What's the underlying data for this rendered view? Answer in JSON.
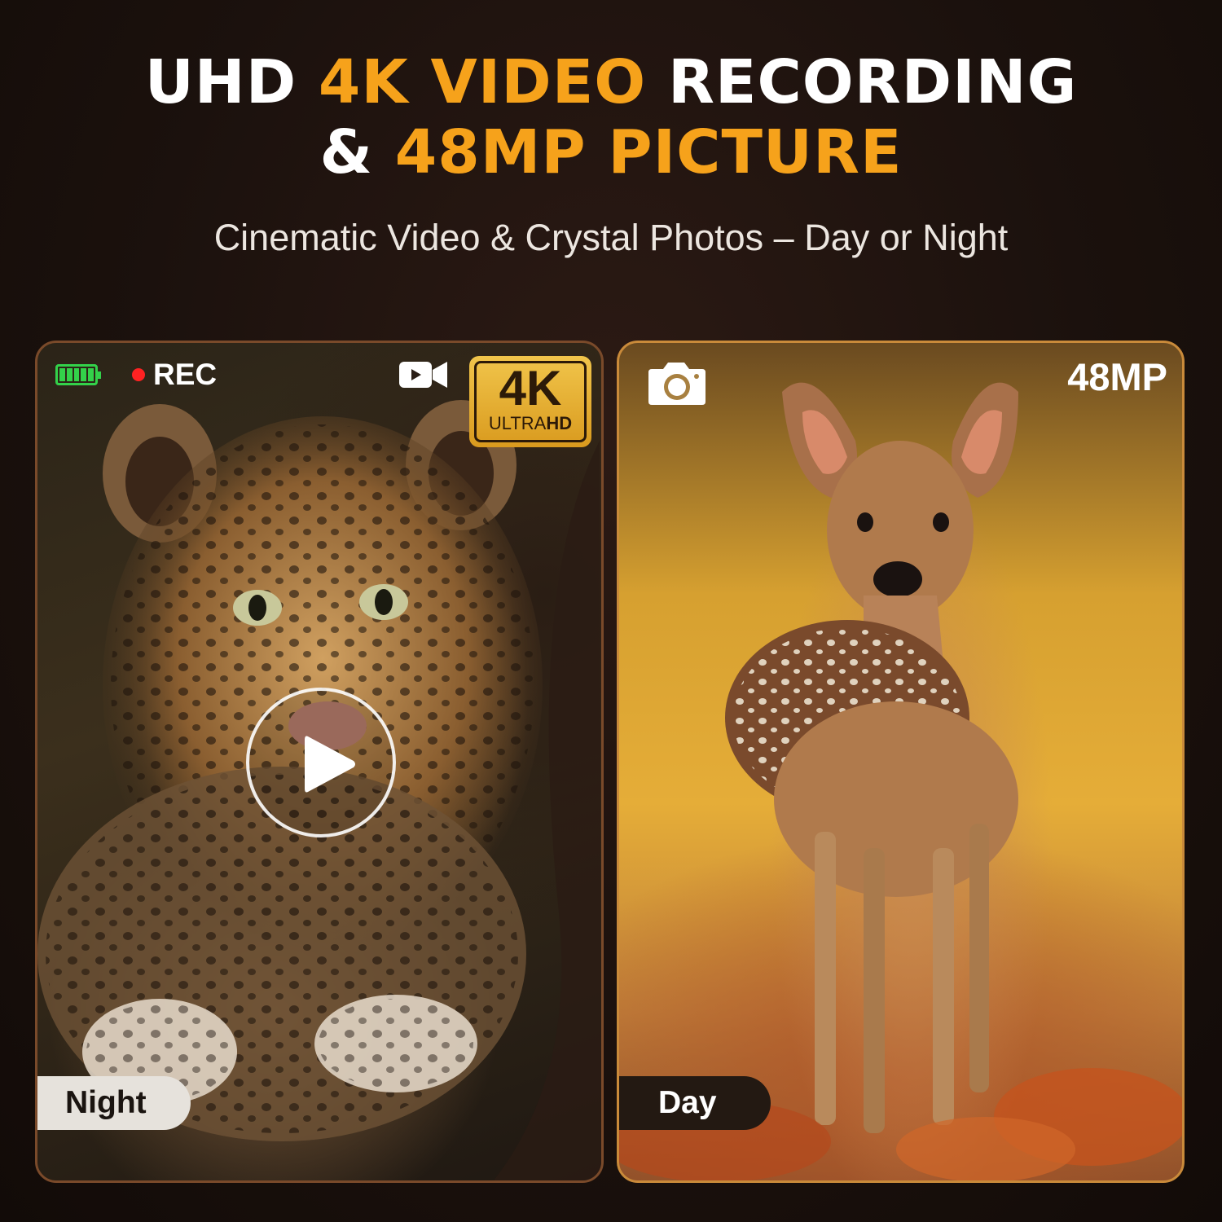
{
  "headline": {
    "line1_part1": "UHD ",
    "line1_accent": "4K VIDEO",
    "line1_part2": " RECORDING",
    "line2_part1": "& ",
    "line2_accent": "48MP PICTURE"
  },
  "subtitle": "Cinematic Video & Crystal Photos – Day or Night",
  "video_panel": {
    "battery_icon": "battery-full-icon",
    "rec_label": "REC",
    "camera_icon": "video-camera-icon",
    "badge": {
      "main": "4K",
      "ultra": "ULTRA",
      "hd": "HD"
    },
    "play_icon": "play-icon",
    "mode_label": "Night",
    "subject": "leopard-photo"
  },
  "photo_panel": {
    "camera_icon": "photo-camera-icon",
    "resolution_label": "48MP",
    "mode_label": "Day",
    "subject": "fawn-photo"
  },
  "colors": {
    "accent": "#f6a21b",
    "battery": "#33d24a",
    "rec_dot": "#ff2222",
    "background": "#1b110d"
  }
}
